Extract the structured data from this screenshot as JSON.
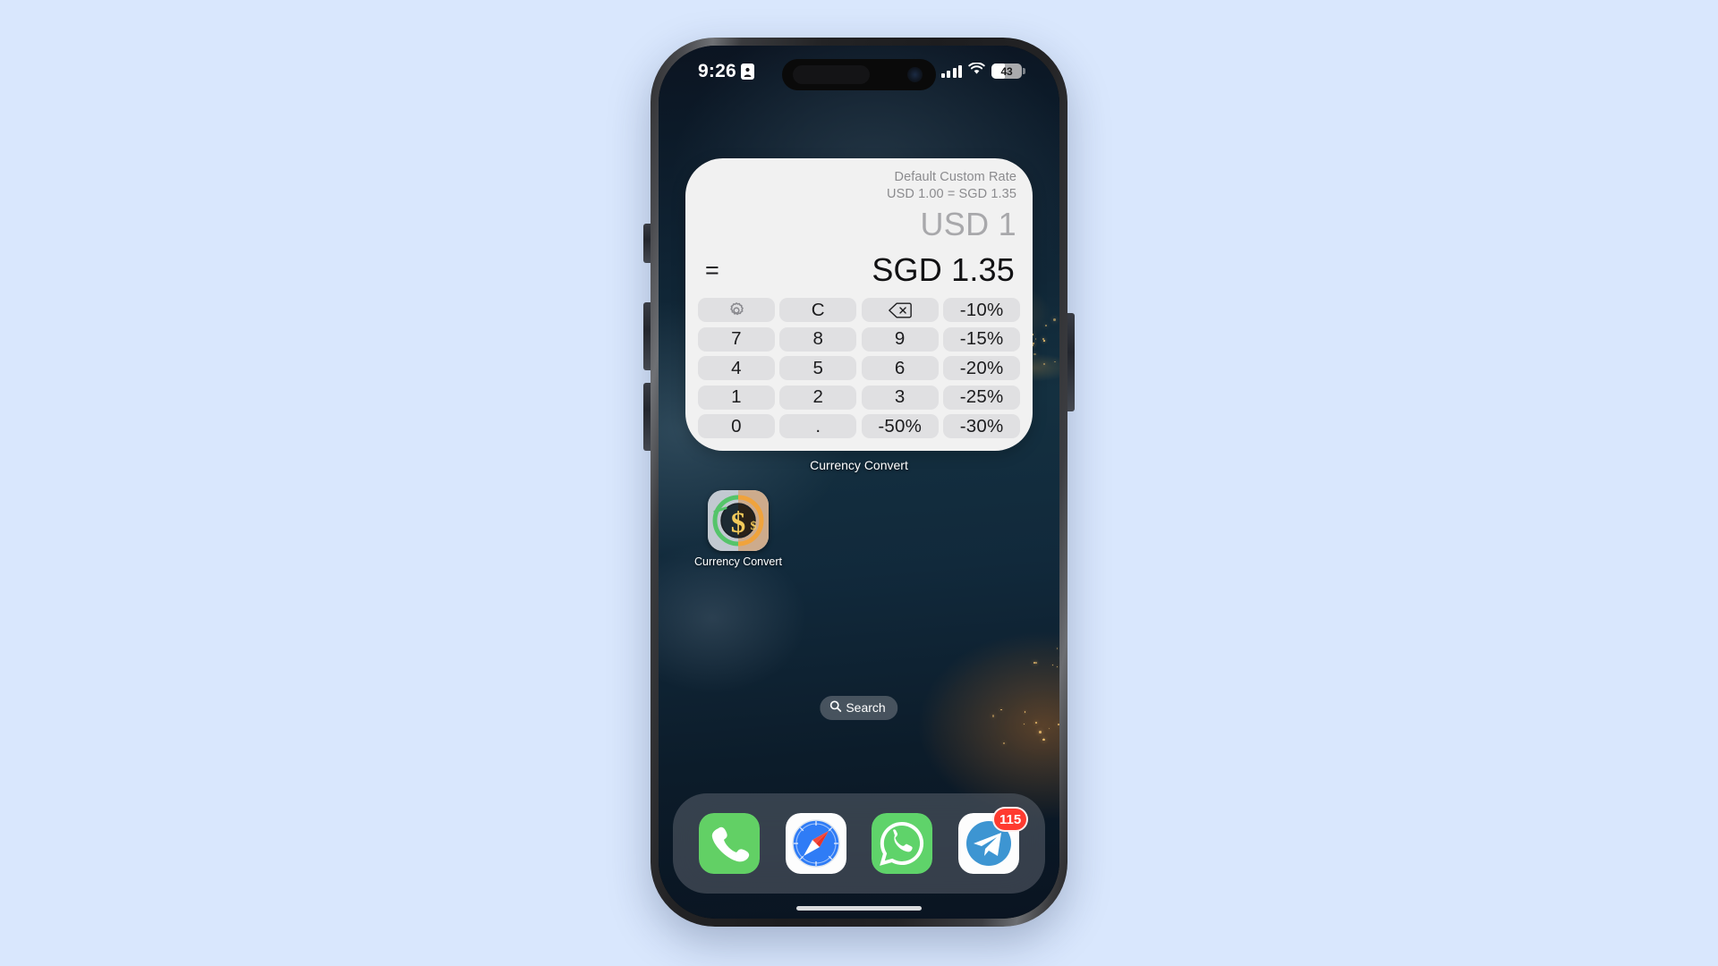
{
  "page": {
    "background_color": "#d9e7fd"
  },
  "status_bar": {
    "time": "9:26",
    "recording_icon": "screen-record-icon",
    "signal_icon": "cellular-signal-icon",
    "wifi_icon": "wifi-icon",
    "battery_percent": "43",
    "battery_level": 43
  },
  "widget": {
    "name": "Currency Convert",
    "rate_label": "Default Custom Rate",
    "rate_line": "USD 1.00 = SGD 1.35",
    "amount": "USD 1",
    "equals": "=",
    "result": "SGD 1.35",
    "caption": "Currency Convert",
    "keys": [
      {
        "label": "",
        "name": "settings-key",
        "icon": "gear-icon"
      },
      {
        "label": "C",
        "name": "clear-key",
        "icon": ""
      },
      {
        "label": "",
        "name": "backspace-key",
        "icon": "backspace-icon"
      },
      {
        "label": "-10%",
        "name": "discount-10-key",
        "icon": ""
      },
      {
        "label": "7",
        "name": "digit-7-key",
        "icon": ""
      },
      {
        "label": "8",
        "name": "digit-8-key",
        "icon": ""
      },
      {
        "label": "9",
        "name": "digit-9-key",
        "icon": ""
      },
      {
        "label": "-15%",
        "name": "discount-15-key",
        "icon": ""
      },
      {
        "label": "4",
        "name": "digit-4-key",
        "icon": ""
      },
      {
        "label": "5",
        "name": "digit-5-key",
        "icon": ""
      },
      {
        "label": "6",
        "name": "digit-6-key",
        "icon": ""
      },
      {
        "label": "-20%",
        "name": "discount-20-key",
        "icon": ""
      },
      {
        "label": "1",
        "name": "digit-1-key",
        "icon": ""
      },
      {
        "label": "2",
        "name": "digit-2-key",
        "icon": ""
      },
      {
        "label": "3",
        "name": "digit-3-key",
        "icon": ""
      },
      {
        "label": "-25%",
        "name": "discount-25-key",
        "icon": ""
      },
      {
        "label": "0",
        "name": "digit-0-key",
        "icon": ""
      },
      {
        "label": ".",
        "name": "decimal-key",
        "icon": ""
      },
      {
        "label": "-50%",
        "name": "discount-50-key",
        "icon": ""
      },
      {
        "label": "-30%",
        "name": "discount-30-key",
        "icon": ""
      }
    ]
  },
  "home_screen": {
    "app": {
      "label": "Currency Convert",
      "icon": "currency-convert-icon"
    },
    "search": {
      "label": "Search",
      "icon": "search-icon"
    }
  },
  "dock": {
    "apps": [
      {
        "label": "Phone",
        "icon": "phone-icon",
        "badge": ""
      },
      {
        "label": "Safari",
        "icon": "safari-icon",
        "badge": ""
      },
      {
        "label": "WhatsApp",
        "icon": "whatsapp-icon",
        "badge": ""
      },
      {
        "label": "Telegram",
        "icon": "telegram-icon",
        "badge": "115"
      }
    ]
  },
  "colors": {
    "accent_blue": "#2f7cf6",
    "badge_red": "#ff3b30",
    "widget_bg": "#f1f1f1",
    "key_bg": "#e0e0e2"
  }
}
